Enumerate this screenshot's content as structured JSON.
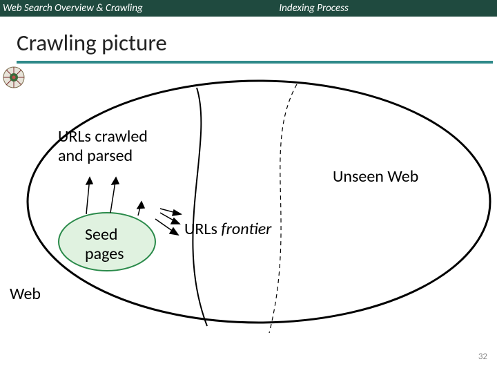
{
  "header": {
    "left": "Web Search Overview & Crawling",
    "right": "Indexing Process"
  },
  "title": "Crawling picture",
  "labels": {
    "crawled": "URLs crawled\nand parsed",
    "unseen": "Unseen Web",
    "seed": "Seed\npages",
    "frontier_prefix": "URLs ",
    "frontier_italic": "frontier",
    "web": "Web"
  },
  "page_number": "32",
  "colors": {
    "header_bg": "#1f4a3f",
    "rule": "#2f8a8a",
    "seed_ellipse_stroke": "#2a8a4a",
    "seed_ellipse_fill": "#d9f0d9"
  }
}
